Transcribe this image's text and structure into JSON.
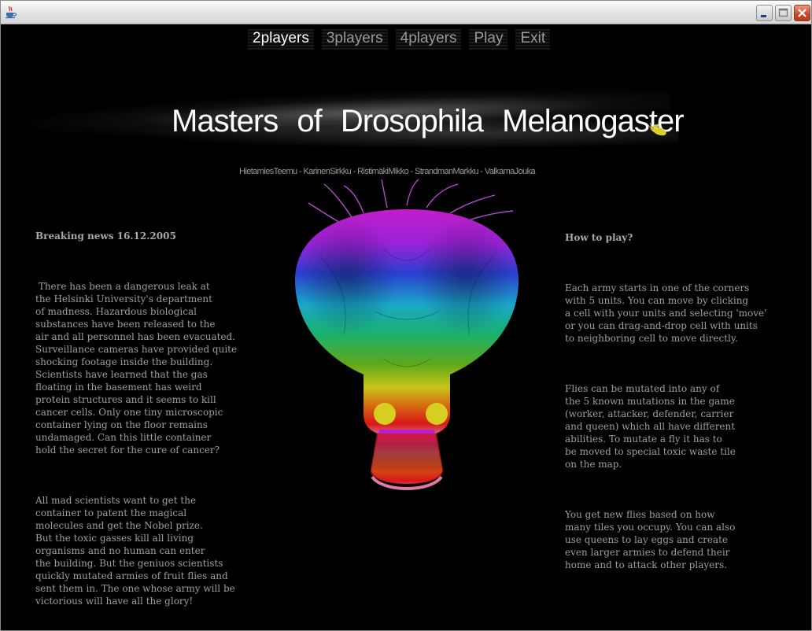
{
  "window": {
    "icon": "java-cup-icon",
    "controls": {
      "minimize": "minimize-icon",
      "maximize": "maximize-icon",
      "close": "close-icon"
    }
  },
  "menu": {
    "items": [
      {
        "label": "2players",
        "active": true
      },
      {
        "label": "3players",
        "active": false
      },
      {
        "label": "4players",
        "active": false
      },
      {
        "label": "Play",
        "active": false
      },
      {
        "label": "Exit",
        "active": false
      }
    ]
  },
  "banner": {
    "title": "Masters of Drosophila Melanogaster",
    "credits": "HietamiesTeemu  -  KarinenSirkku  -  RistimäkiMikko  -  StrandmanMarkku  -  ValkamaJouka"
  },
  "news": {
    "heading": "Breaking news 16.12.2005",
    "paragraphs": [
      " There has been a dangerous leak at\nthe Helsinki University's department\nof madness. Hazardous biological\nsubstances have been released to the\nair and all personnel has been evacuated.\nSurveillance cameras have provided quite\nshocking footage inside the building.\nScientists have learned that the gas\nfloating in the basement has weird\nprotein structures and it seems to kill\ncancer cells. Only one tiny microscopic\ncontainer lying on the floor remains\nundamaged. Can this little container\nhold the secret for the cure of cancer?",
      "All mad scientists want to get the\ncontainer to patent the magical\nmolecules and get the Nobel prize.\nBut the toxic gasses kill all living\norganisms and no human can enter\nthe building. But the geniuos scientists\nquickly mutated armies of fruit flies and\nsent them in. The one whose army will be\nvictorious will have all the glory!"
    ]
  },
  "howto": {
    "heading": "How to play?",
    "paragraphs": [
      "Each army starts in one of the corners\nwith 5 units. You can move by clicking\na cell with your units and selecting 'move'\nor you can drag-and-drop cell with units\nto neighboring cell to move directly.",
      "Flies can be mutated into any of\nthe 5 known mutations in the game\n(worker, attacker, defender, carrier\nand queen) which all have different\nabilities. To mutate a fly it has to\nbe moved to special toxic waste tile\non the map.",
      "You get new flies based on how\nmany tiles you occupy. You can also\nuse queens to lay eggs and create\neven larger armies to defend their\nhome and to attack other players."
    ]
  }
}
